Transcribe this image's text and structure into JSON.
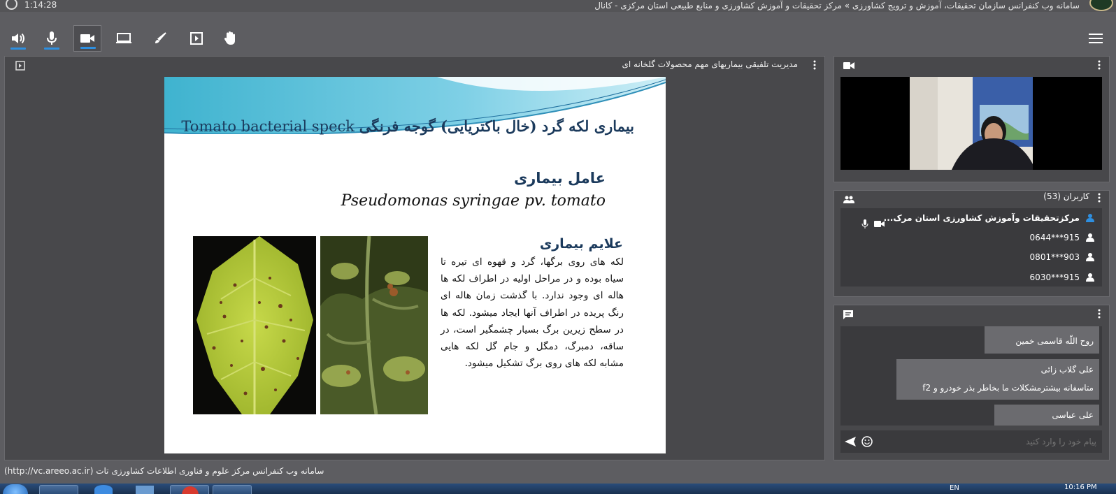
{
  "window": {
    "title": "سامانه وب کنفرانس سازمان تحقیقات، آموزش و ترویج کشاورزی » مرکز تحقیقات و آموزش کشاورزی و منابع طبیعی استان مرکزی - کانال",
    "elapsed_time": "1:14:28"
  },
  "toolbar": {
    "icons": [
      "speaker-icon",
      "microphone-icon",
      "camera-icon",
      "screen-share-icon",
      "brush-icon",
      "play-icon",
      "raise-hand-icon",
      "menu-icon"
    ]
  },
  "presentation": {
    "title": "مدیریت تلفیقی بیماریهای مهم محصولات گلخانه ای",
    "slide": {
      "title_fa": "بیماری لکه گرد (خال باکتریایی) گوجه فرنگی",
      "title_en": "Tomato bacterial speck",
      "agent_heading": "عامل بیماری",
      "agent_name": "Pseudomonas syringae pv. tomato",
      "symptoms_heading": "علایم بیماری",
      "symptoms_text": "لکه های روی برگها، گرد و قهوه ای تیره تا سیاه بوده و در مراحل اولیه در اطراف لکه ها هاله ای وجود ندارد. با گذشت زمان هاله ای رنگ پریده در اطراف آنها ایجاد میشود. لکه ها در سطح زیرین برگ بسیار چشمگیر است، در ساقه، دمبرگ، دمگل و جام گل لکه هایی مشابه لکه های روی برگ تشکیل میشود."
    }
  },
  "users": {
    "title": "کاربران (53)",
    "list": [
      {
        "name": "مرکزتحقیقات وآموزش کشاورزی استان مرک...",
        "is_presenter": true
      },
      {
        "name": "915***0644",
        "is_presenter": false
      },
      {
        "name": "903***0801",
        "is_presenter": false
      },
      {
        "name": "915***6030",
        "is_presenter": false
      }
    ]
  },
  "chat": {
    "messages": [
      {
        "text": "روح اللّه قاسمی خمین"
      },
      {
        "sender": "علی گلاب زائی",
        "text": "متاسفانه بیشترمشکلات ما بخاطر بذر خودرو و f2"
      },
      {
        "text": "علی عباسی"
      }
    ],
    "input_placeholder": "پیام خود را وارد کنید"
  },
  "footer": {
    "text": "سامانه وب کنفرانس مرکز علوم و فناوری اطلاعات کشاورزی تات (http://vc.areeo.ac.ir)"
  },
  "taskbar": {
    "lang": "EN",
    "clock": "10:16 PM"
  },
  "colors": {
    "accent": "#2e8fe0",
    "background": "#5d5d61",
    "panel": "#48484b",
    "slide_title": "#1b3a5c"
  }
}
